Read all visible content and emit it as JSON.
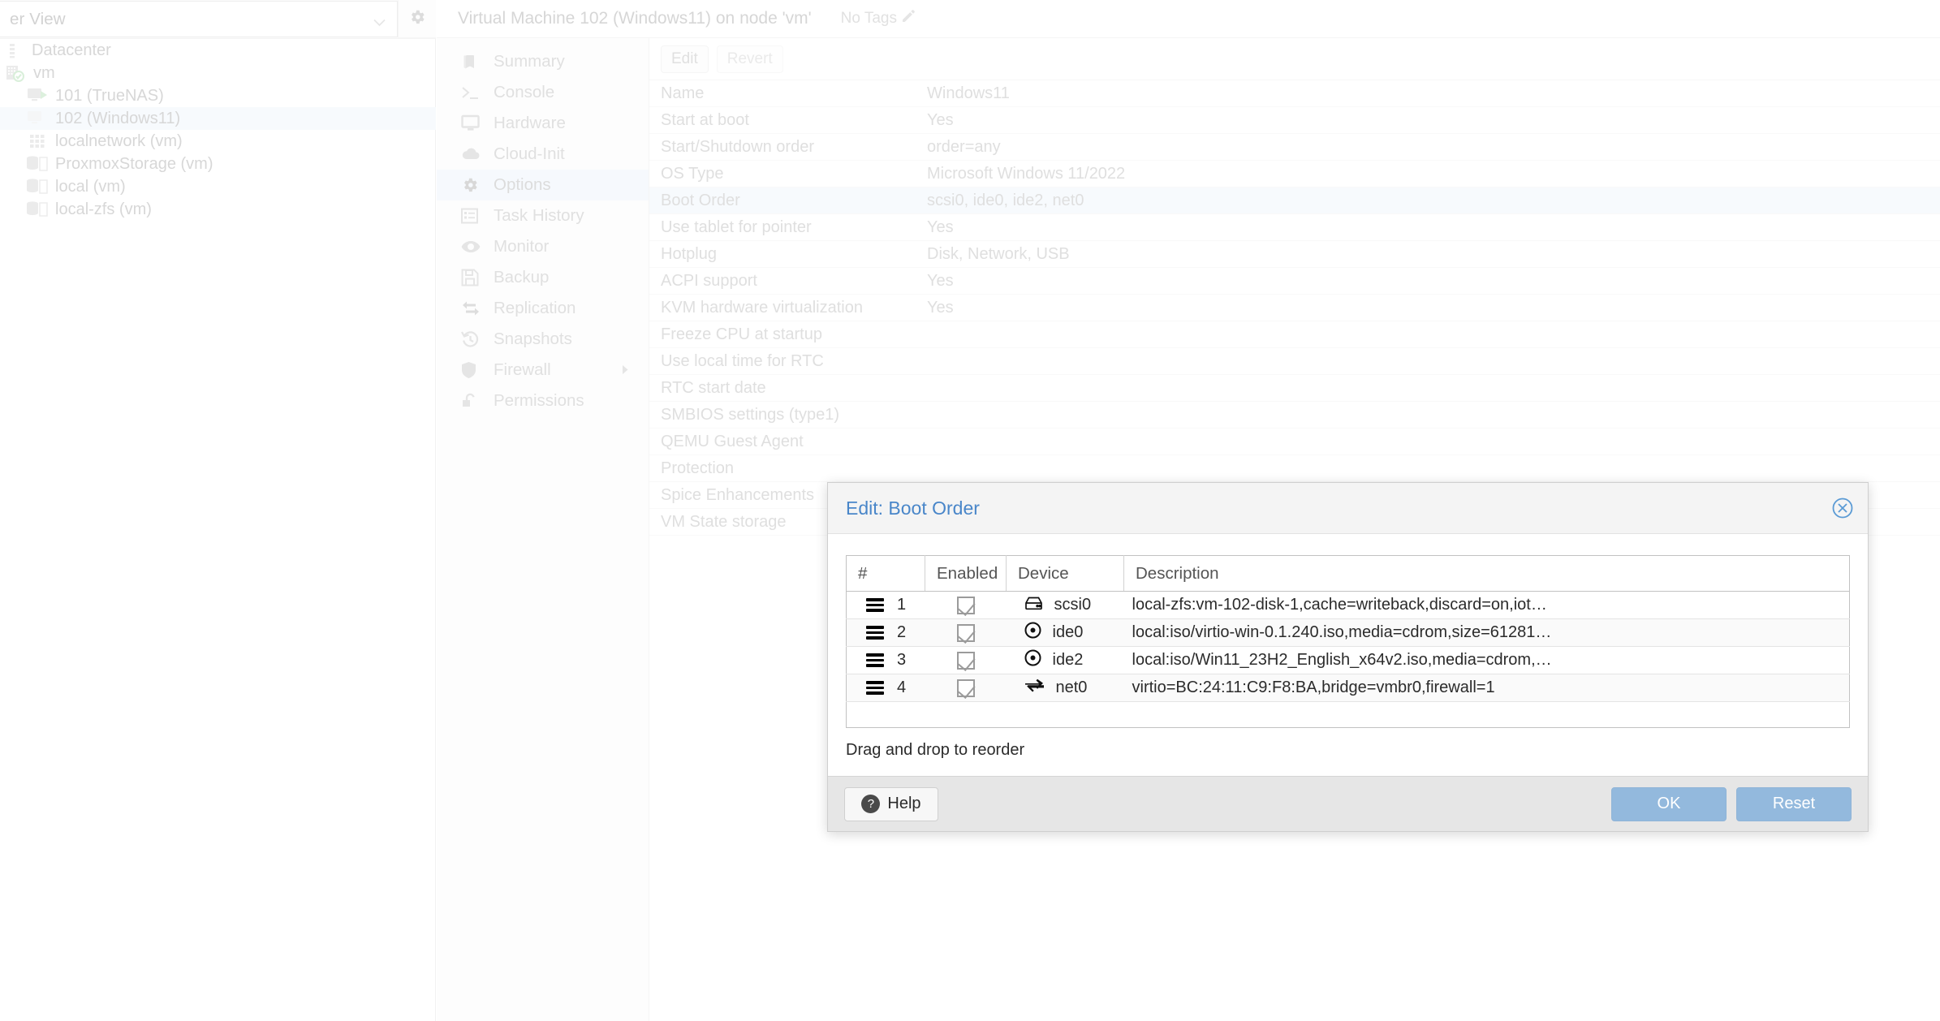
{
  "sidebar": {
    "view_selector": {
      "value": "er View",
      "icon": "chevron-down-icon"
    },
    "settings_icon": "gear-icon",
    "tree": [
      {
        "label": "Datacenter",
        "icon": "datacenter-icon",
        "depth": 0,
        "selected": false
      },
      {
        "label": "vm",
        "icon": "node-online-icon",
        "depth": 1,
        "selected": false
      },
      {
        "label": "101 (TrueNAS)",
        "icon": "qemu-running-icon",
        "depth": 2,
        "selected": false
      },
      {
        "label": "102 (Windows11)",
        "icon": "qemu-stopped-icon",
        "depth": 2,
        "selected": true
      },
      {
        "label": "localnetwork (vm)",
        "icon": "network-icon",
        "depth": 2,
        "selected": false
      },
      {
        "label": "ProxmoxStorage (vm)",
        "icon": "storage-icon",
        "depth": 2,
        "selected": false
      },
      {
        "label": "local (vm)",
        "icon": "storage-icon",
        "depth": 2,
        "selected": false
      },
      {
        "label": "local-zfs (vm)",
        "icon": "storage-icon",
        "depth": 2,
        "selected": false
      }
    ]
  },
  "header": {
    "title": "Virtual Machine 102 (Windows11) on node 'vm'",
    "tags_label": "No Tags",
    "tags_edit_icon": "pencil-icon"
  },
  "nav": {
    "items": [
      {
        "label": "Summary",
        "icon": "book-icon",
        "active": false,
        "submenu": false
      },
      {
        "label": "Console",
        "icon": "terminal-icon",
        "active": false,
        "submenu": false
      },
      {
        "label": "Hardware",
        "icon": "monitor-icon",
        "active": false,
        "submenu": false
      },
      {
        "label": "Cloud-Init",
        "icon": "cloud-icon",
        "active": false,
        "submenu": false
      },
      {
        "label": "Options",
        "icon": "gear-icon",
        "active": true,
        "submenu": false
      },
      {
        "label": "Task History",
        "icon": "list-icon",
        "active": false,
        "submenu": false
      },
      {
        "label": "Monitor",
        "icon": "eye-icon",
        "active": false,
        "submenu": false
      },
      {
        "label": "Backup",
        "icon": "floppy-disk-icon",
        "active": false,
        "submenu": false
      },
      {
        "label": "Replication",
        "icon": "exchange-icon",
        "active": false,
        "submenu": false
      },
      {
        "label": "Snapshots",
        "icon": "history-icon",
        "active": false,
        "submenu": false
      },
      {
        "label": "Firewall",
        "icon": "shield-icon",
        "active": false,
        "submenu": true
      },
      {
        "label": "Permissions",
        "icon": "unlock-icon",
        "active": false,
        "submenu": false
      }
    ]
  },
  "options": {
    "toolbar": {
      "edit_label": "Edit",
      "revert_label": "Revert"
    },
    "rows": [
      {
        "key": "Name",
        "value": "Windows11",
        "highlight": false
      },
      {
        "key": "Start at boot",
        "value": "Yes",
        "highlight": false
      },
      {
        "key": "Start/Shutdown order",
        "value": "order=any",
        "highlight": false
      },
      {
        "key": "OS Type",
        "value": "Microsoft Windows 11/2022",
        "highlight": false
      },
      {
        "key": "Boot Order",
        "value": "scsi0, ide0, ide2, net0",
        "highlight": true
      },
      {
        "key": "Use tablet for pointer",
        "value": "Yes",
        "highlight": false
      },
      {
        "key": "Hotplug",
        "value": "Disk, Network, USB",
        "highlight": false
      },
      {
        "key": "ACPI support",
        "value": "Yes",
        "highlight": false
      },
      {
        "key": "KVM hardware virtualization",
        "value": "Yes",
        "highlight": false
      },
      {
        "key": "Freeze CPU at startup",
        "value": "",
        "highlight": false
      },
      {
        "key": "Use local time for RTC",
        "value": "",
        "highlight": false
      },
      {
        "key": "RTC start date",
        "value": "",
        "highlight": false
      },
      {
        "key": "SMBIOS settings (type1)",
        "value": "",
        "highlight": false
      },
      {
        "key": "QEMU Guest Agent",
        "value": "",
        "highlight": false
      },
      {
        "key": "Protection",
        "value": "",
        "highlight": false
      },
      {
        "key": "Spice Enhancements",
        "value": "",
        "highlight": false
      },
      {
        "key": "VM State storage",
        "value": "",
        "highlight": false
      }
    ]
  },
  "dialog": {
    "title": "Edit: Boot Order",
    "close_icon": "close-circle-icon",
    "columns": {
      "num": "#",
      "enabled": "Enabled",
      "device": "Device",
      "description": "Description"
    },
    "rows": [
      {
        "num": "1",
        "enabled": true,
        "device": "scsi0",
        "device_icon": "hard-disk-icon",
        "description": "local-zfs:vm-102-disk-1,cache=writeback,discard=on,iot…"
      },
      {
        "num": "2",
        "enabled": true,
        "device": "ide0",
        "device_icon": "cdrom-icon",
        "description": "local:iso/virtio-win-0.1.240.iso,media=cdrom,size=61281…"
      },
      {
        "num": "3",
        "enabled": true,
        "device": "ide2",
        "device_icon": "cdrom-icon",
        "description": "local:iso/Win11_23H2_English_x64v2.iso,media=cdrom,…"
      },
      {
        "num": "4",
        "enabled": true,
        "device": "net0",
        "device_icon": "network-exchange-icon",
        "description": "virtio=BC:24:11:C9:F8:BA,bridge=vmbr0,firewall=1"
      }
    ],
    "hint": "Drag and drop to reorder",
    "footer": {
      "help_label": "Help",
      "help_icon": "question-circle-icon",
      "ok_label": "OK",
      "reset_label": "Reset"
    }
  },
  "colors": {
    "accent_blue": "#4986c9",
    "selection_blue": "#eaf2fb",
    "primary_button": "#93b9dd",
    "footer_gray": "#e6e6e6"
  }
}
